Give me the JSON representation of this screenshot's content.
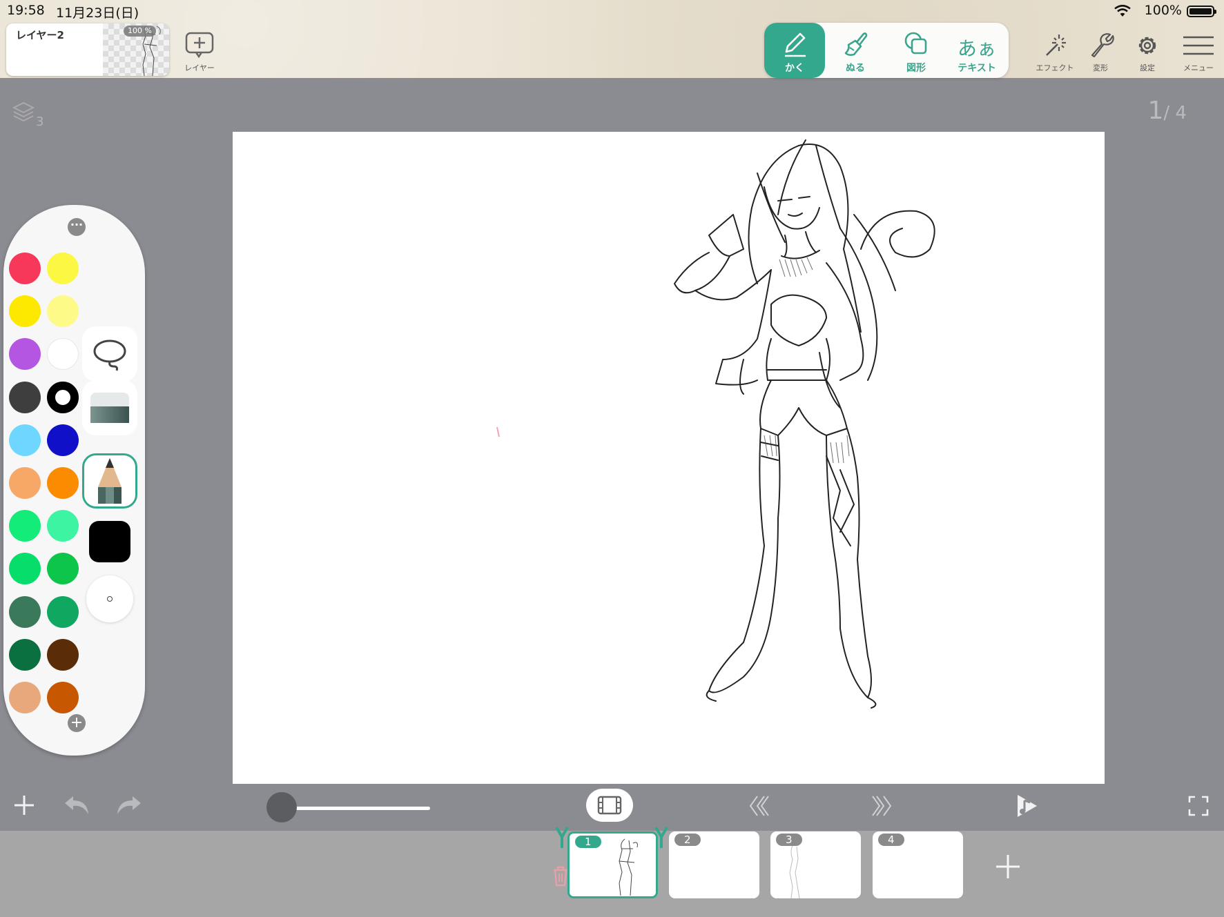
{
  "status_bar": {
    "time": "19:58",
    "date": "11月23日(日)",
    "battery": "100%"
  },
  "layer": {
    "name": "レイヤー2",
    "opacity": "100 %",
    "add_label": "レイヤー"
  },
  "tools": {
    "draw": "かく",
    "fill": "ぬる",
    "shape": "図形",
    "text_glyph": "あぁ",
    "text": "テキスト"
  },
  "toolbar_right": {
    "effect": "エフェクト",
    "transform": "変形",
    "settings": "設定",
    "menu": "メニュー"
  },
  "canvas": {
    "layer_count": "3",
    "page_current": "1",
    "page_total": "4"
  },
  "palette": {
    "colors": [
      "#f7385a",
      "#fcf742",
      "#fde800",
      "#fdfa88",
      "#b456e2",
      "#ffffff",
      "#3e3e3e",
      "#000000",
      "#6fd7ff",
      "#1010c8",
      "#f7a866",
      "#fb8b00",
      "#14ec7a",
      "#3cf4a2",
      "#06dd6a",
      "#0dc54a",
      "#3a7a5a",
      "#10a761",
      "#0b7040",
      "#5a2d08",
      "#e9a87b",
      "#c75700"
    ],
    "current_color": "#000000"
  },
  "timeline": {
    "frames": [
      {
        "label": "1"
      },
      {
        "label": "2"
      },
      {
        "label": "3"
      },
      {
        "label": "4"
      }
    ],
    "onion_skin": 0
  },
  "accent": "#33a88c"
}
